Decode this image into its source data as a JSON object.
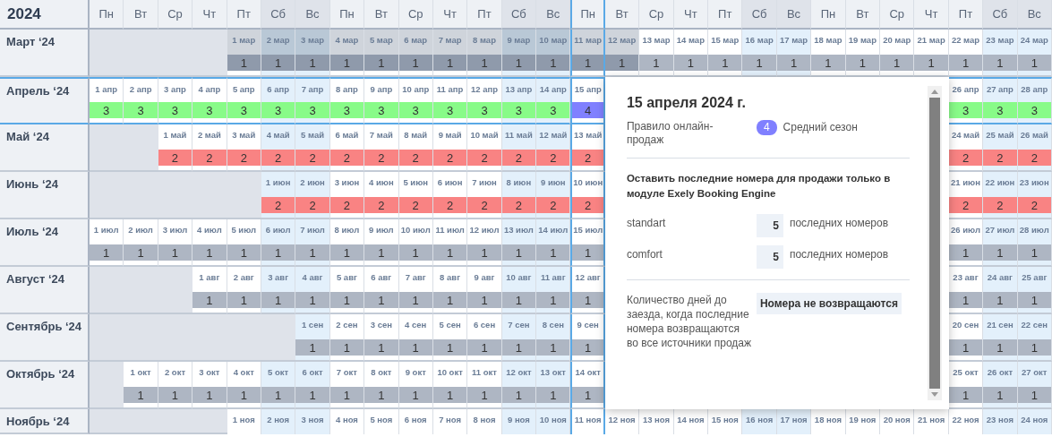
{
  "year": "2024",
  "weekdays": [
    {
      "label": "Пн",
      "weekend": false,
      "selected": false
    },
    {
      "label": "Вт",
      "weekend": false,
      "selected": false
    },
    {
      "label": "Ср",
      "weekend": false,
      "selected": false
    },
    {
      "label": "Чт",
      "weekend": false,
      "selected": false
    },
    {
      "label": "Пт",
      "weekend": false,
      "selected": false
    },
    {
      "label": "Сб",
      "weekend": true,
      "selected": false
    },
    {
      "label": "Вс",
      "weekend": true,
      "selected": false
    },
    {
      "label": "Пн",
      "weekend": false,
      "selected": false
    },
    {
      "label": "Вт",
      "weekend": false,
      "selected": false
    },
    {
      "label": "Ср",
      "weekend": false,
      "selected": false
    },
    {
      "label": "Чт",
      "weekend": false,
      "selected": false
    },
    {
      "label": "Пт",
      "weekend": false,
      "selected": false
    },
    {
      "label": "Сб",
      "weekend": true,
      "selected": false
    },
    {
      "label": "Вс",
      "weekend": true,
      "selected": false
    },
    {
      "label": "Пн",
      "weekend": false,
      "selected": true
    },
    {
      "label": "Вт",
      "weekend": false,
      "selected": false
    },
    {
      "label": "Ср",
      "weekend": false,
      "selected": false
    },
    {
      "label": "Чт",
      "weekend": false,
      "selected": false
    },
    {
      "label": "Пт",
      "weekend": false,
      "selected": false
    },
    {
      "label": "Сб",
      "weekend": true,
      "selected": false
    },
    {
      "label": "Вс",
      "weekend": true,
      "selected": false
    },
    {
      "label": "Пн",
      "weekend": false,
      "selected": false
    },
    {
      "label": "Вт",
      "weekend": false,
      "selected": false
    },
    {
      "label": "Ср",
      "weekend": false,
      "selected": false
    },
    {
      "label": "Чт",
      "weekend": false,
      "selected": false
    },
    {
      "label": "Пт",
      "weekend": false,
      "selected": false
    },
    {
      "label": "Сб",
      "weekend": true,
      "selected": false
    },
    {
      "label": "Вс",
      "weekend": true,
      "selected": false
    }
  ],
  "months": [
    {
      "label": "Март ‘24",
      "selected": false,
      "color": "#aeb6c3",
      "cells": [
        {
          "kind": "blank"
        },
        {
          "kind": "blank"
        },
        {
          "kind": "blank"
        },
        {
          "kind": "blank"
        },
        {
          "kind": "day",
          "date": "1 мар",
          "value": "1",
          "past": true,
          "color": "#8f9aab"
        },
        {
          "kind": "day",
          "date": "2 мар",
          "value": "1",
          "past": true,
          "color": "#8f9aab"
        },
        {
          "kind": "day",
          "date": "3 мар",
          "value": "1",
          "past": true,
          "color": "#8f9aab"
        },
        {
          "kind": "day",
          "date": "4 мар",
          "value": "1",
          "past": true,
          "color": "#8f9aab"
        },
        {
          "kind": "day",
          "date": "5 мар",
          "value": "1",
          "past": true,
          "color": "#8f9aab"
        },
        {
          "kind": "day",
          "date": "6 мар",
          "value": "1",
          "past": true,
          "color": "#8f9aab"
        },
        {
          "kind": "day",
          "date": "7 мар",
          "value": "1",
          "past": true,
          "color": "#8f9aab"
        },
        {
          "kind": "day",
          "date": "8 мар",
          "value": "1",
          "past": true,
          "color": "#8f9aab"
        },
        {
          "kind": "day",
          "date": "9 мар",
          "value": "1",
          "past": true,
          "color": "#8f9aab"
        },
        {
          "kind": "day",
          "date": "10 мар",
          "value": "1",
          "past": true,
          "color": "#8f9aab"
        },
        {
          "kind": "day",
          "date": "11 мар",
          "value": "1",
          "past": true,
          "color": "#8f9aab"
        },
        {
          "kind": "day",
          "date": "12 мар",
          "value": "1",
          "past": true,
          "color": "#8f9aab"
        },
        {
          "kind": "day",
          "date": "13 мар",
          "value": "1",
          "past": false
        },
        {
          "kind": "day",
          "date": "14 мар",
          "value": "1",
          "past": false
        },
        {
          "kind": "day",
          "date": "15 мар",
          "value": "1",
          "past": false
        },
        {
          "kind": "day",
          "date": "16 мар",
          "value": "1",
          "past": false
        },
        {
          "kind": "day",
          "date": "17 мар",
          "value": "1",
          "past": false
        },
        {
          "kind": "day",
          "date": "18 мар",
          "value": "1",
          "past": false
        },
        {
          "kind": "day",
          "date": "19 мар",
          "value": "1",
          "past": false
        },
        {
          "kind": "day",
          "date": "20 мар",
          "value": "1",
          "past": false
        },
        {
          "kind": "day",
          "date": "21 мар",
          "value": "1",
          "past": false
        },
        {
          "kind": "day",
          "date": "22 мар",
          "value": "1",
          "past": false
        },
        {
          "kind": "day",
          "date": "23 мар",
          "value": "1",
          "past": false
        },
        {
          "kind": "day",
          "date": "24 мар",
          "value": "1",
          "past": false
        }
      ]
    },
    {
      "label": "Апрель ‘24",
      "selected": true,
      "color": "#88fb88",
      "cells": [
        {
          "kind": "day",
          "date": "1 апр",
          "value": "3"
        },
        {
          "kind": "day",
          "date": "2 апр",
          "value": "3"
        },
        {
          "kind": "day",
          "date": "3 апр",
          "value": "3"
        },
        {
          "kind": "day",
          "date": "4 апр",
          "value": "3"
        },
        {
          "kind": "day",
          "date": "5 апр",
          "value": "3"
        },
        {
          "kind": "day",
          "date": "6 апр",
          "value": "3"
        },
        {
          "kind": "day",
          "date": "7 апр",
          "value": "3"
        },
        {
          "kind": "day",
          "date": "8 апр",
          "value": "3"
        },
        {
          "kind": "day",
          "date": "9 апр",
          "value": "3"
        },
        {
          "kind": "day",
          "date": "10 апр",
          "value": "3"
        },
        {
          "kind": "day",
          "date": "11 апр",
          "value": "3"
        },
        {
          "kind": "day",
          "date": "12 апр",
          "value": "3"
        },
        {
          "kind": "day",
          "date": "13 апр",
          "value": "3"
        },
        {
          "kind": "day",
          "date": "14 апр",
          "value": "3"
        },
        {
          "kind": "day",
          "date": "15 апр",
          "value": "4",
          "color": "#8080ff"
        },
        {
          "kind": "covered"
        },
        {
          "kind": "covered"
        },
        {
          "kind": "covered"
        },
        {
          "kind": "covered"
        },
        {
          "kind": "covered"
        },
        {
          "kind": "covered"
        },
        {
          "kind": "covered"
        },
        {
          "kind": "covered"
        },
        {
          "kind": "covered"
        },
        {
          "kind": "covered"
        },
        {
          "kind": "day",
          "date": "26 апр",
          "value": "3"
        },
        {
          "kind": "day",
          "date": "27 апр",
          "value": "3"
        },
        {
          "kind": "day",
          "date": "28 апр",
          "value": "3"
        }
      ]
    },
    {
      "label": "Май ‘24",
      "selected": false,
      "color": "#f98383",
      "cells": [
        {
          "kind": "blank"
        },
        {
          "kind": "blank"
        },
        {
          "kind": "day",
          "date": "1 май",
          "value": "2"
        },
        {
          "kind": "day",
          "date": "2 май",
          "value": "2"
        },
        {
          "kind": "day",
          "date": "3 май",
          "value": "2"
        },
        {
          "kind": "day",
          "date": "4 май",
          "value": "2"
        },
        {
          "kind": "day",
          "date": "5 май",
          "value": "2"
        },
        {
          "kind": "day",
          "date": "6 май",
          "value": "2"
        },
        {
          "kind": "day",
          "date": "7 май",
          "value": "2"
        },
        {
          "kind": "day",
          "date": "8 май",
          "value": "2"
        },
        {
          "kind": "day",
          "date": "9 май",
          "value": "2"
        },
        {
          "kind": "day",
          "date": "10 май",
          "value": "2"
        },
        {
          "kind": "day",
          "date": "11 май",
          "value": "2"
        },
        {
          "kind": "day",
          "date": "12 май",
          "value": "2"
        },
        {
          "kind": "day",
          "date": "13 май",
          "value": "2"
        },
        {
          "kind": "covered"
        },
        {
          "kind": "covered"
        },
        {
          "kind": "covered"
        },
        {
          "kind": "covered"
        },
        {
          "kind": "covered"
        },
        {
          "kind": "covered"
        },
        {
          "kind": "covered"
        },
        {
          "kind": "covered"
        },
        {
          "kind": "covered"
        },
        {
          "kind": "covered"
        },
        {
          "kind": "day",
          "date": "24 май",
          "value": "2"
        },
        {
          "kind": "day",
          "date": "25 май",
          "value": "2"
        },
        {
          "kind": "day",
          "date": "26 май",
          "value": "2"
        }
      ]
    },
    {
      "label": "Июнь ‘24",
      "selected": false,
      "color": "#f98383",
      "cells": [
        {
          "kind": "blank"
        },
        {
          "kind": "blank"
        },
        {
          "kind": "blank"
        },
        {
          "kind": "blank"
        },
        {
          "kind": "blank"
        },
        {
          "kind": "day",
          "date": "1 июн",
          "value": "2"
        },
        {
          "kind": "day",
          "date": "2 июн",
          "value": "2"
        },
        {
          "kind": "day",
          "date": "3 июн",
          "value": "2"
        },
        {
          "kind": "day",
          "date": "4 июн",
          "value": "2"
        },
        {
          "kind": "day",
          "date": "5 июн",
          "value": "2"
        },
        {
          "kind": "day",
          "date": "6 июн",
          "value": "2"
        },
        {
          "kind": "day",
          "date": "7 июн",
          "value": "2"
        },
        {
          "kind": "day",
          "date": "8 июн",
          "value": "2"
        },
        {
          "kind": "day",
          "date": "9 июн",
          "value": "2"
        },
        {
          "kind": "day",
          "date": "10 июн",
          "value": "2"
        },
        {
          "kind": "covered"
        },
        {
          "kind": "covered"
        },
        {
          "kind": "covered"
        },
        {
          "kind": "covered"
        },
        {
          "kind": "covered"
        },
        {
          "kind": "covered"
        },
        {
          "kind": "covered"
        },
        {
          "kind": "covered"
        },
        {
          "kind": "covered"
        },
        {
          "kind": "covered"
        },
        {
          "kind": "day",
          "date": "21 июн",
          "value": "2"
        },
        {
          "kind": "day",
          "date": "22 июн",
          "value": "2"
        },
        {
          "kind": "day",
          "date": "23 июн",
          "value": "2"
        }
      ]
    },
    {
      "label": "Июль ‘24",
      "selected": false,
      "color": "#aeb6c3",
      "cells": [
        {
          "kind": "day",
          "date": "1 июл",
          "value": "1"
        },
        {
          "kind": "day",
          "date": "2 июл",
          "value": "1"
        },
        {
          "kind": "day",
          "date": "3 июл",
          "value": "1"
        },
        {
          "kind": "day",
          "date": "4 июл",
          "value": "1"
        },
        {
          "kind": "day",
          "date": "5 июл",
          "value": "1"
        },
        {
          "kind": "day",
          "date": "6 июл",
          "value": "1"
        },
        {
          "kind": "day",
          "date": "7 июл",
          "value": "1"
        },
        {
          "kind": "day",
          "date": "8 июл",
          "value": "1"
        },
        {
          "kind": "day",
          "date": "9 июл",
          "value": "1"
        },
        {
          "kind": "day",
          "date": "10 июл",
          "value": "1"
        },
        {
          "kind": "day",
          "date": "11 июл",
          "value": "1"
        },
        {
          "kind": "day",
          "date": "12 июл",
          "value": "1"
        },
        {
          "kind": "day",
          "date": "13 июл",
          "value": "1"
        },
        {
          "kind": "day",
          "date": "14 июл",
          "value": "1"
        },
        {
          "kind": "day",
          "date": "15 июл",
          "value": "1"
        },
        {
          "kind": "covered"
        },
        {
          "kind": "covered"
        },
        {
          "kind": "covered"
        },
        {
          "kind": "covered"
        },
        {
          "kind": "covered"
        },
        {
          "kind": "covered"
        },
        {
          "kind": "covered"
        },
        {
          "kind": "covered"
        },
        {
          "kind": "covered"
        },
        {
          "kind": "covered"
        },
        {
          "kind": "day",
          "date": "26 июл",
          "value": "1"
        },
        {
          "kind": "day",
          "date": "27 июл",
          "value": "1"
        },
        {
          "kind": "day",
          "date": "28 июл",
          "value": "1"
        }
      ]
    },
    {
      "label": "Август ‘24",
      "selected": false,
      "color": "#aeb6c3",
      "cells": [
        {
          "kind": "blank"
        },
        {
          "kind": "blank"
        },
        {
          "kind": "blank"
        },
        {
          "kind": "day",
          "date": "1 авг",
          "value": "1"
        },
        {
          "kind": "day",
          "date": "2 авг",
          "value": "1"
        },
        {
          "kind": "day",
          "date": "3 авг",
          "value": "1"
        },
        {
          "kind": "day",
          "date": "4 авг",
          "value": "1"
        },
        {
          "kind": "day",
          "date": "5 авг",
          "value": "1"
        },
        {
          "kind": "day",
          "date": "6 авг",
          "value": "1"
        },
        {
          "kind": "day",
          "date": "7 авг",
          "value": "1"
        },
        {
          "kind": "day",
          "date": "8 авг",
          "value": "1"
        },
        {
          "kind": "day",
          "date": "9 авг",
          "value": "1"
        },
        {
          "kind": "day",
          "date": "10 авг",
          "value": "1"
        },
        {
          "kind": "day",
          "date": "11 авг",
          "value": "1"
        },
        {
          "kind": "day",
          "date": "12 авг",
          "value": "1"
        },
        {
          "kind": "covered"
        },
        {
          "kind": "covered"
        },
        {
          "kind": "covered"
        },
        {
          "kind": "covered"
        },
        {
          "kind": "covered"
        },
        {
          "kind": "covered"
        },
        {
          "kind": "covered"
        },
        {
          "kind": "covered"
        },
        {
          "kind": "covered"
        },
        {
          "kind": "covered"
        },
        {
          "kind": "day",
          "date": "23 авг",
          "value": "1"
        },
        {
          "kind": "day",
          "date": "24 авг",
          "value": "1"
        },
        {
          "kind": "day",
          "date": "25 авг",
          "value": "1"
        }
      ]
    },
    {
      "label": "Сентябрь ‘24",
      "selected": false,
      "color": "#aeb6c3",
      "cells": [
        {
          "kind": "blank"
        },
        {
          "kind": "blank"
        },
        {
          "kind": "blank"
        },
        {
          "kind": "blank"
        },
        {
          "kind": "blank"
        },
        {
          "kind": "blank"
        },
        {
          "kind": "day",
          "date": "1 сен",
          "value": "1"
        },
        {
          "kind": "day",
          "date": "2 сен",
          "value": "1"
        },
        {
          "kind": "day",
          "date": "3 сен",
          "value": "1"
        },
        {
          "kind": "day",
          "date": "4 сен",
          "value": "1"
        },
        {
          "kind": "day",
          "date": "5 сен",
          "value": "1"
        },
        {
          "kind": "day",
          "date": "6 сен",
          "value": "1"
        },
        {
          "kind": "day",
          "date": "7 сен",
          "value": "1"
        },
        {
          "kind": "day",
          "date": "8 сен",
          "value": "1"
        },
        {
          "kind": "day",
          "date": "9 сен",
          "value": "1"
        },
        {
          "kind": "covered"
        },
        {
          "kind": "covered"
        },
        {
          "kind": "covered"
        },
        {
          "kind": "covered"
        },
        {
          "kind": "covered"
        },
        {
          "kind": "covered"
        },
        {
          "kind": "covered"
        },
        {
          "kind": "covered"
        },
        {
          "kind": "covered"
        },
        {
          "kind": "covered"
        },
        {
          "kind": "day",
          "date": "20 сен",
          "value": "1"
        },
        {
          "kind": "day",
          "date": "21 сен",
          "value": "1"
        },
        {
          "kind": "day",
          "date": "22 сен",
          "value": "1"
        }
      ]
    },
    {
      "label": "Октябрь ‘24",
      "selected": false,
      "color": "#aeb6c3",
      "cells": [
        {
          "kind": "blank"
        },
        {
          "kind": "day",
          "date": "1 окт",
          "value": "1"
        },
        {
          "kind": "day",
          "date": "2 окт",
          "value": "1"
        },
        {
          "kind": "day",
          "date": "3 окт",
          "value": "1"
        },
        {
          "kind": "day",
          "date": "4 окт",
          "value": "1"
        },
        {
          "kind": "day",
          "date": "5 окт",
          "value": "1"
        },
        {
          "kind": "day",
          "date": "6 окт",
          "value": "1"
        },
        {
          "kind": "day",
          "date": "7 окт",
          "value": "1"
        },
        {
          "kind": "day",
          "date": "8 окт",
          "value": "1"
        },
        {
          "kind": "day",
          "date": "9 окт",
          "value": "1"
        },
        {
          "kind": "day",
          "date": "10 окт",
          "value": "1"
        },
        {
          "kind": "day",
          "date": "11 окт",
          "value": "1"
        },
        {
          "kind": "day",
          "date": "12 окт",
          "value": "1"
        },
        {
          "kind": "day",
          "date": "13 окт",
          "value": "1"
        },
        {
          "kind": "day",
          "date": "14 окт",
          "value": "1"
        },
        {
          "kind": "covered"
        },
        {
          "kind": "covered"
        },
        {
          "kind": "covered"
        },
        {
          "kind": "covered"
        },
        {
          "kind": "covered"
        },
        {
          "kind": "covered"
        },
        {
          "kind": "covered"
        },
        {
          "kind": "covered"
        },
        {
          "kind": "covered"
        },
        {
          "kind": "covered"
        },
        {
          "kind": "day",
          "date": "25 окт",
          "value": "1"
        },
        {
          "kind": "day",
          "date": "26 окт",
          "value": "1"
        },
        {
          "kind": "day",
          "date": "27 окт",
          "value": "1"
        }
      ]
    },
    {
      "label": "Ноябрь ‘24",
      "selected": false,
      "cells": [
        {
          "kind": "blank"
        },
        {
          "kind": "blank"
        },
        {
          "kind": "blank"
        },
        {
          "kind": "blank"
        },
        {
          "kind": "day",
          "date": "1 ноя"
        },
        {
          "kind": "day",
          "date": "2 ноя"
        },
        {
          "kind": "day",
          "date": "3 ноя"
        },
        {
          "kind": "day",
          "date": "4 ноя"
        },
        {
          "kind": "day",
          "date": "5 ноя"
        },
        {
          "kind": "day",
          "date": "6 ноя"
        },
        {
          "kind": "day",
          "date": "7 ноя"
        },
        {
          "kind": "day",
          "date": "8 ноя"
        },
        {
          "kind": "day",
          "date": "9 ноя"
        },
        {
          "kind": "day",
          "date": "10 ноя"
        },
        {
          "kind": "day",
          "date": "11 ноя"
        },
        {
          "kind": "day",
          "date": "12 ноя"
        },
        {
          "kind": "day",
          "date": "13 ноя"
        },
        {
          "kind": "day",
          "date": "14 ноя"
        },
        {
          "kind": "day",
          "date": "15 ноя"
        },
        {
          "kind": "day",
          "date": "16 ноя"
        },
        {
          "kind": "day",
          "date": "17 ноя"
        },
        {
          "kind": "day",
          "date": "18 ноя"
        },
        {
          "kind": "day",
          "date": "19 ноя"
        },
        {
          "kind": "day",
          "date": "20 ноя"
        },
        {
          "kind": "day",
          "date": "21 ноя"
        },
        {
          "kind": "day",
          "date": "22 ноя"
        },
        {
          "kind": "day",
          "date": "23 ноя"
        },
        {
          "kind": "day",
          "date": "24 ноя"
        }
      ]
    }
  ],
  "popup": {
    "title": "15 апреля 2024 г.",
    "rule_label": "Правило онлайн-продаж",
    "rule_badge": "4",
    "rule_name": "Средний сезон",
    "reserve_heading": "Оставить последние номера для продажи только в модуле Exely Booking Engine",
    "rooms": [
      {
        "name": "standart",
        "count": "5",
        "unit": "последних номеров"
      },
      {
        "name": "comfort",
        "count": "5",
        "unit": "последних номеров"
      }
    ],
    "return_label": "Количество дней до заезда, когда последние номера возвращаются во все источники продаж",
    "return_value": "Номера не возвращаются"
  }
}
